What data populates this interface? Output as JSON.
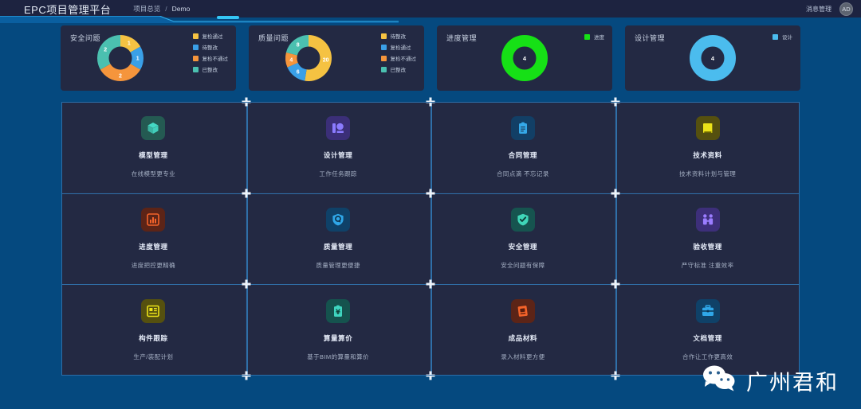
{
  "header": {
    "brand": "EPC项目管理平台",
    "breadcrumb": [
      {
        "label": "项目总览"
      },
      {
        "label": "/"
      },
      {
        "label": "Demo"
      }
    ],
    "message_label": "消息管理",
    "avatar_initials": "AD"
  },
  "colors": {
    "page_bg": "#05497f",
    "panel_bg": "#232943",
    "topbar_bg": "#1d2340",
    "grid_line": "#2f6fa8",
    "yellow": "#f5c242",
    "blue": "#3aa0e8",
    "orange": "#f5953c",
    "teal": "#4bc0b0",
    "green": "#16e016",
    "lightblue": "#4bbcee"
  },
  "chart_data": [
    {
      "type": "pie",
      "title": "安全问题",
      "categories": [
        "复检通过",
        "待整改",
        "复检不通过",
        "已整改"
      ],
      "values": [
        1,
        1,
        2,
        2
      ],
      "colors": [
        "#f5c242",
        "#3aa0e8",
        "#f5953c",
        "#4bc0b0"
      ],
      "legend_position": "right",
      "donut": true
    },
    {
      "type": "pie",
      "title": "质量问题",
      "categories": [
        "待整改",
        "复检通过",
        "复检不通过",
        "已整改"
      ],
      "values": [
        20,
        6,
        4,
        8
      ],
      "colors": [
        "#f5c242",
        "#3aa0e8",
        "#f5953c",
        "#4bc0b0"
      ],
      "legend_position": "right",
      "donut": true
    },
    {
      "type": "pie",
      "title": "进度管理",
      "categories": [
        "进度"
      ],
      "values": [
        4
      ],
      "colors": [
        "#16e016"
      ],
      "legend_position": "right",
      "donut": true,
      "center_label": "4"
    },
    {
      "type": "pie",
      "title": "设计管理",
      "categories": [
        "设计"
      ],
      "values": [
        4
      ],
      "colors": [
        "#4bbcee"
      ],
      "legend_position": "right",
      "donut": true,
      "center_label": "4"
    }
  ],
  "stat_cards": [
    {
      "title": "安全问题",
      "legend": [
        {
          "label": "复检通过",
          "color": "#f5c242"
        },
        {
          "label": "待整改",
          "color": "#3aa0e8"
        },
        {
          "label": "复检不通过",
          "color": "#f5953c"
        },
        {
          "label": "已整改",
          "color": "#4bc0b0"
        }
      ],
      "slices": [
        {
          "label": "1",
          "value": 1,
          "color": "#f5c242"
        },
        {
          "label": "1",
          "value": 1,
          "color": "#3aa0e8"
        },
        {
          "label": "2",
          "value": 2,
          "color": "#f5953c"
        },
        {
          "label": "2",
          "value": 2,
          "color": "#4bc0b0"
        }
      ]
    },
    {
      "title": "质量问题",
      "legend": [
        {
          "label": "待整改",
          "color": "#f5c242"
        },
        {
          "label": "复检通过",
          "color": "#3aa0e8"
        },
        {
          "label": "复检不通过",
          "color": "#f5953c"
        },
        {
          "label": "已整改",
          "color": "#4bc0b0"
        }
      ],
      "slices": [
        {
          "label": "20",
          "value": 20,
          "color": "#f5c242"
        },
        {
          "label": "6",
          "value": 6,
          "color": "#3aa0e8"
        },
        {
          "label": "4",
          "value": 4,
          "color": "#f5953c"
        },
        {
          "label": "8",
          "value": 8,
          "color": "#4bc0b0"
        }
      ]
    },
    {
      "title": "进度管理",
      "legend": [
        {
          "label": "进度",
          "color": "#16e016"
        }
      ],
      "slices": [
        {
          "label": "",
          "value": 4,
          "color": "#16e016"
        }
      ],
      "center_label": "4"
    },
    {
      "title": "设计管理",
      "legend": [
        {
          "label": "设计",
          "color": "#4bbcee"
        }
      ],
      "slices": [
        {
          "label": "",
          "value": 4,
          "color": "#4bbcee"
        }
      ],
      "center_label": "4"
    }
  ],
  "modules": [
    {
      "title": "模型管理",
      "desc": "在线模型更专业",
      "icon": "cube-icon",
      "icon_bg": "#245a52",
      "icon_fg": "#44d9c4"
    },
    {
      "title": "设计管理",
      "desc": "工作任务跟踪",
      "icon": "design-board-icon",
      "icon_bg": "#3b2f78",
      "icon_fg": "#8b7bff"
    },
    {
      "title": "合同管理",
      "desc": "合同点滴 不忘记录",
      "icon": "clipboard-icon",
      "icon_bg": "#123f66",
      "icon_fg": "#34a8e8"
    },
    {
      "title": "技术资料",
      "desc": "技术资料计划与管理",
      "icon": "book-icon",
      "icon_bg": "#55500f",
      "icon_fg": "#ece319"
    },
    {
      "title": "进度管理",
      "desc": "进度把控更精确",
      "icon": "bar-chart-icon",
      "icon_bg": "#5c2417",
      "icon_fg": "#f4632a"
    },
    {
      "title": "质量管理",
      "desc": "质量管理更便捷",
      "icon": "shield-q-icon",
      "icon_bg": "#0f4168",
      "icon_fg": "#2fa6e8"
    },
    {
      "title": "安全管理",
      "desc": "安全问题有保障",
      "icon": "shield-check-icon",
      "icon_bg": "#16544f",
      "icon_fg": "#3fd6b8"
    },
    {
      "title": "验收管理",
      "desc": "严守标准 注重效率",
      "icon": "people-icon",
      "icon_bg": "#3d2f7a",
      "icon_fg": "#9b7dff"
    },
    {
      "title": "构件跟踪",
      "desc": "生产/装配计划",
      "icon": "grid-list-icon",
      "icon_bg": "#55500f",
      "icon_fg": "#ece319"
    },
    {
      "title": "算量算价",
      "desc": "基于BIM的算量和算价",
      "icon": "yuan-clipboard-icon",
      "icon_bg": "#15534e",
      "icon_fg": "#3fd6c0"
    },
    {
      "title": "成品材料",
      "desc": "录入材料更方便",
      "icon": "material-box-icon",
      "icon_bg": "#5c2417",
      "icon_fg": "#f4632a"
    },
    {
      "title": "文档管理",
      "desc": "合作让工作更高效",
      "icon": "briefcase-icon",
      "icon_bg": "#0f4168",
      "icon_fg": "#2fa6e8"
    }
  ],
  "watermark": {
    "text": "广州君和",
    "icon": "wechat-icon"
  }
}
